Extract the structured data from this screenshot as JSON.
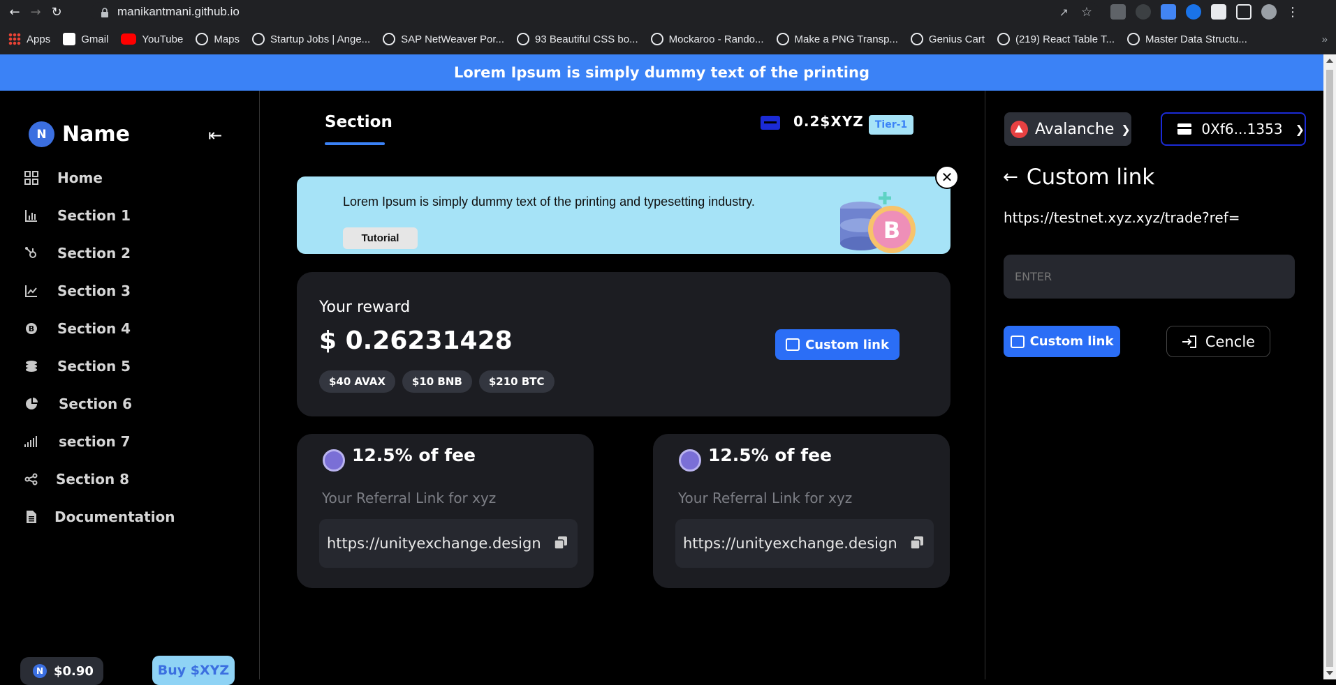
{
  "browser": {
    "url": "manikantmani.github.io",
    "bookmarks": [
      {
        "label": "Apps",
        "icon": "apps-grid-icon"
      },
      {
        "label": "Gmail",
        "icon": "gmail-icon"
      },
      {
        "label": "YouTube",
        "icon": "youtube-icon"
      },
      {
        "label": "Maps",
        "icon": "globe-icon"
      },
      {
        "label": "Startup Jobs | Ange...",
        "icon": "globe-icon"
      },
      {
        "label": "SAP NetWeaver Por...",
        "icon": "globe-icon"
      },
      {
        "label": "93 Beautiful CSS bo...",
        "icon": "globe-icon"
      },
      {
        "label": "Mockaroo - Rando...",
        "icon": "globe-icon"
      },
      {
        "label": "Make a PNG Transp...",
        "icon": "globe-icon"
      },
      {
        "label": "Genius Cart",
        "icon": "globe-icon"
      },
      {
        "label": "(219) React Table T...",
        "icon": "globe-icon"
      },
      {
        "label": "Master Data Structu...",
        "icon": "globe-icon"
      }
    ]
  },
  "banner": {
    "text": "Lorem Ipsum is simply dummy text of the printing"
  },
  "sidebar": {
    "brand_initial": "N",
    "brand_name": "Name",
    "items": [
      {
        "label": "Home",
        "icon": "grid-icon"
      },
      {
        "label": "Section 1",
        "icon": "bar-chart-icon"
      },
      {
        "label": "Section 2",
        "icon": "hubspot-icon"
      },
      {
        "label": "Section 3",
        "icon": "line-chart-icon"
      },
      {
        "label": "Section 4",
        "icon": "bitcoin-icon"
      },
      {
        "label": "Section 5",
        "icon": "coins-icon"
      },
      {
        "label": "Section 6",
        "icon": "pie-chart-icon"
      },
      {
        "label": "section 7",
        "icon": "signal-icon"
      },
      {
        "label": "Section 8",
        "icon": "share-nodes-icon"
      },
      {
        "label": "Documentation",
        "icon": "document-icon"
      }
    ],
    "wallet_initial": "N",
    "wallet_balance": "$0.90",
    "buy_label": "Buy $XYZ"
  },
  "main": {
    "tab": "Section",
    "balance": "0.2$XYZ",
    "tier": "Tier-1",
    "promo": {
      "text": "Lorem Ipsum is simply dummy text of the printing and typesetting industry.",
      "button": "Tutorial"
    },
    "reward": {
      "label": "Your reward",
      "amount": "$ 0.26231428",
      "chips": [
        "$40 AVAX",
        "$10 BNB",
        "$210 BTC"
      ],
      "button": "Custom link"
    },
    "fee_cards": [
      {
        "percent": "12.5% of fee",
        "subtitle": "Your Referral Link for xyz",
        "link": "https://unityexchange.design"
      },
      {
        "percent": "12.5% of fee",
        "subtitle": "Your Referral Link for xyz",
        "link": "https://unityexchange.design"
      }
    ]
  },
  "right": {
    "chain": "Avalanche",
    "address": "0Xf6...1353",
    "title": "Custom link",
    "ref_url": "https://testnet.xyz.xyz/trade?ref=",
    "input_placeholder": "ENTER",
    "custom_button": "Custom link",
    "cancel_button": "Cencle"
  },
  "colors": {
    "accent": "#2b6ef6",
    "banner": "#3b82f6",
    "promo_bg": "#a6e3f7",
    "card_bg": "#1c1d22"
  }
}
